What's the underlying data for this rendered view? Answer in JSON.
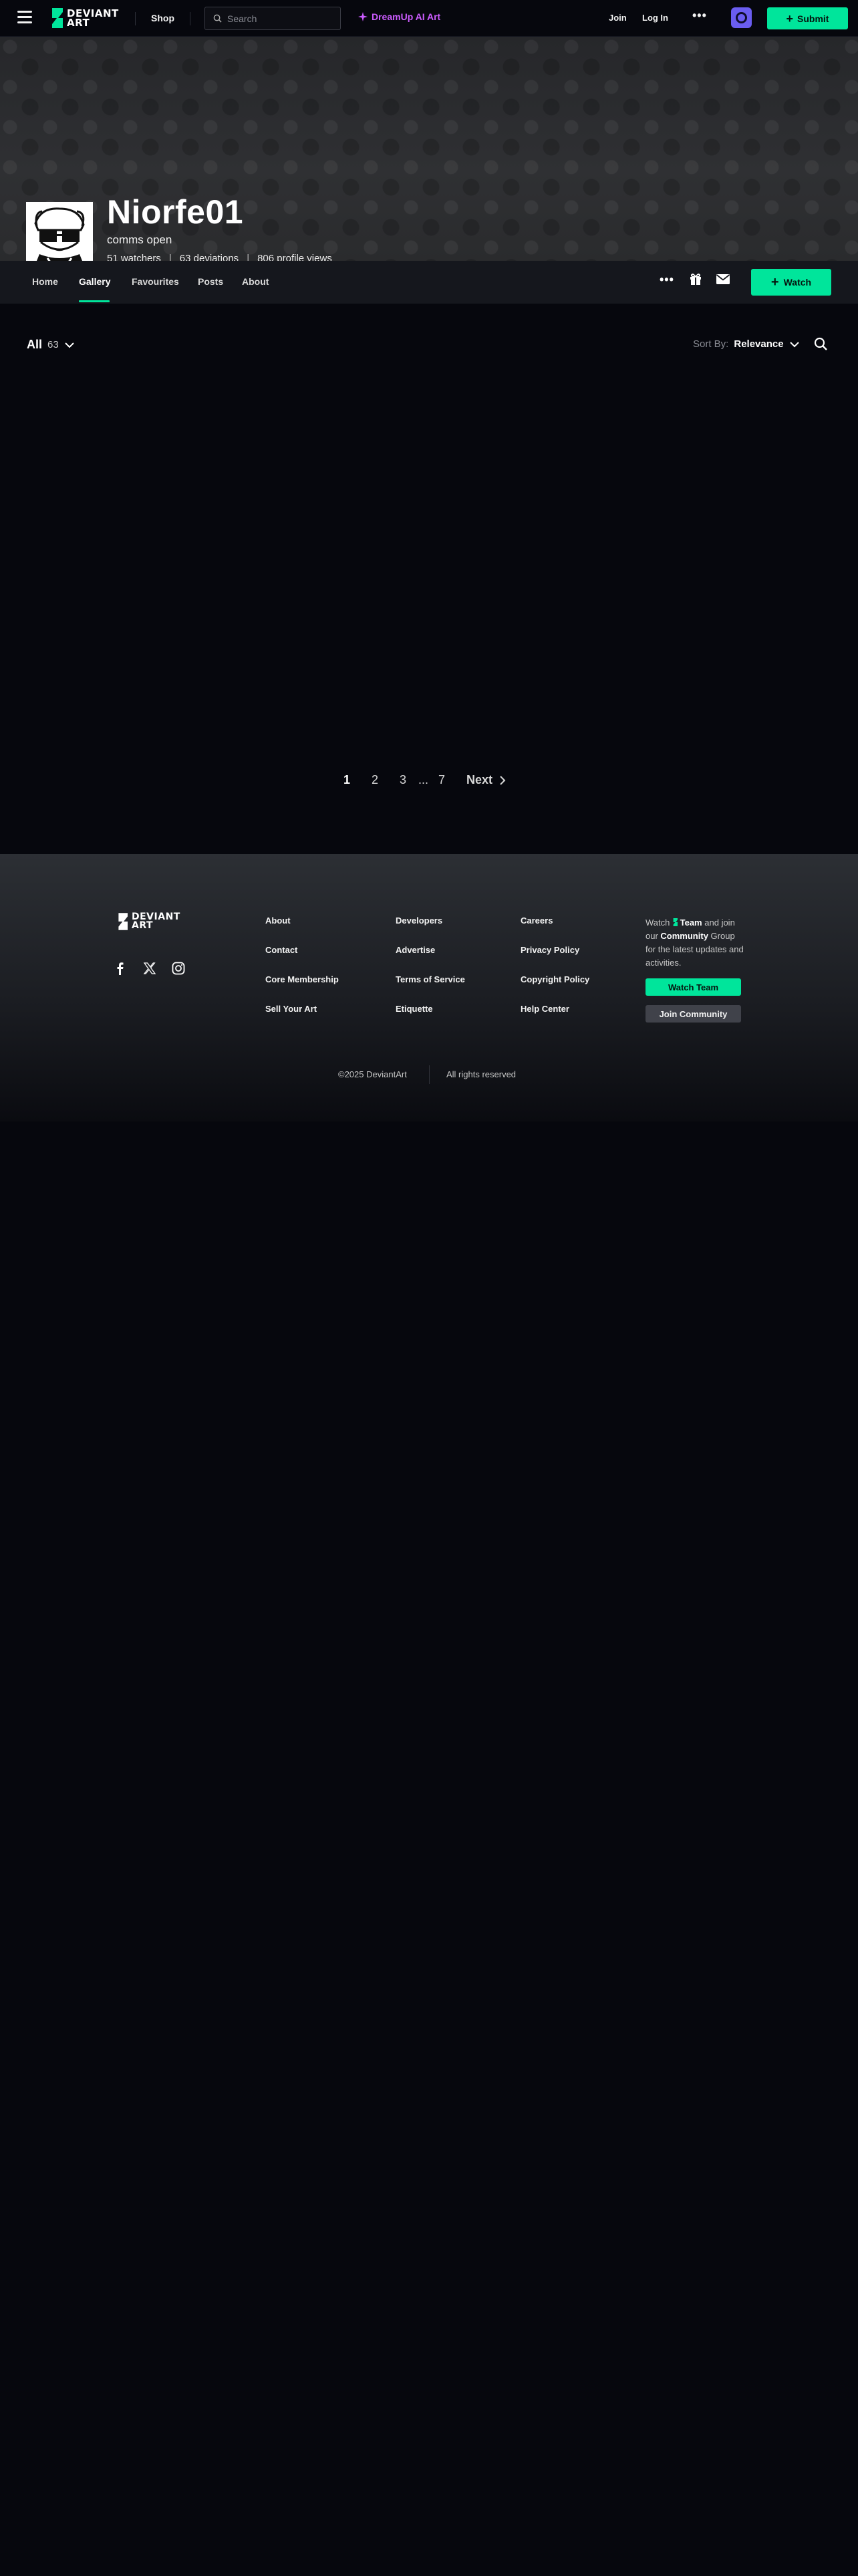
{
  "nav": {
    "logo_line1": "DEVIANT",
    "logo_line2": "ART",
    "shop": "Shop",
    "search_placeholder": "Search",
    "dreamup": "DreamUp AI Art",
    "join": "Join",
    "login": "Log In",
    "more": "•••",
    "submit": "Submit"
  },
  "profile": {
    "username": "Niorfe01",
    "tagline": "comms open",
    "watchers": "51 watchers",
    "deviations": "63 deviations",
    "views": "806 profile views"
  },
  "tabs": [
    {
      "label": "Home"
    },
    {
      "label": "Gallery",
      "active": true
    },
    {
      "label": "Favourites"
    },
    {
      "label": "Posts"
    },
    {
      "label": "About"
    }
  ],
  "tabs_more": "•••",
  "watch_label": "Watch",
  "gallery": {
    "filter_label": "All",
    "filter_count": "63",
    "sort_label": "Sort By:",
    "sort_value": "Relevance"
  },
  "pagination": {
    "pages": [
      "1",
      "2",
      "3",
      "...",
      "7"
    ],
    "current": "1",
    "next": "Next"
  },
  "footer": {
    "links": [
      "About",
      "Contact",
      "Core Membership",
      "Sell Your Art",
      "Developers",
      "Advertise",
      "Terms of Service",
      "Etiquette",
      "Careers",
      "Privacy Policy",
      "Copyright Policy",
      "Help Center"
    ],
    "cta_watch": "Watch",
    "cta_team": "Team",
    "cta_and": "and",
    "cta_join": "join our",
    "cta_community": "Community",
    "cta_rest": "Group for the latest updates and activities.",
    "watch_team_btn": "Watch Team",
    "join_community_btn": "Join Community",
    "copyright": "©2025 DeviantArt",
    "rights": "All rights reserved"
  },
  "colors": {
    "accent": "#00e59b",
    "dreamup": "#cc5cff",
    "core": "#6a5df0",
    "background": "#06070d"
  }
}
